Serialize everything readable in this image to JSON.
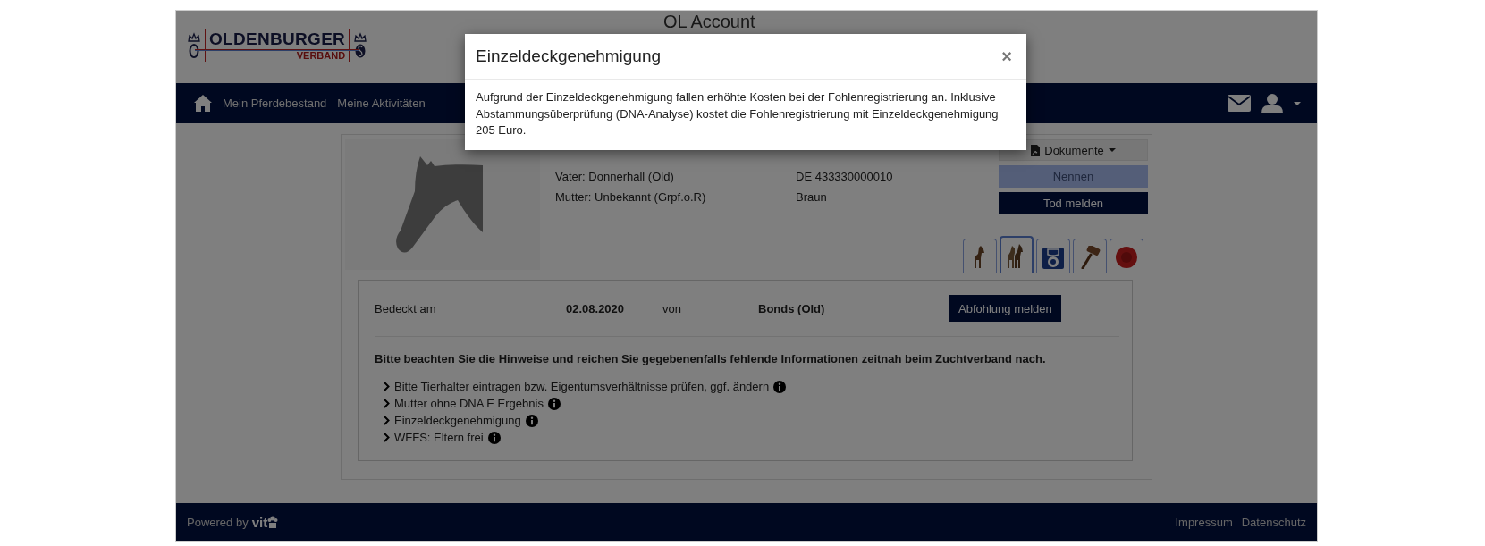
{
  "header": {
    "logo_text": "OLDENBURGER",
    "logo_subtext": "VERBAND",
    "title": "OL Account"
  },
  "nav": {
    "items": [
      {
        "label": "Mein Pferdebestand"
      },
      {
        "label": "Meine Aktivitäten"
      }
    ]
  },
  "horse": {
    "details": [
      {
        "left": "Vater: Donnerhall (Old)",
        "right": "DE 433330000010"
      },
      {
        "left": "Mutter: Unbekannt (Grpf.o.R)",
        "right": "Braun"
      }
    ],
    "actions": [
      {
        "label": "Dokumente",
        "kind": "dropdown",
        "disabled": false
      },
      {
        "label": "Nennen",
        "kind": "button",
        "disabled": true
      },
      {
        "label": "Tod melden",
        "kind": "button",
        "disabled": false
      }
    ],
    "tabs": [
      {
        "kind": "horse",
        "selected": false
      },
      {
        "kind": "horses",
        "selected": true
      },
      {
        "kind": "badge",
        "selected": false
      },
      {
        "kind": "gavel",
        "selected": false
      },
      {
        "kind": "seal",
        "selected": false
      }
    ]
  },
  "breeding": {
    "label": "Bedeckt am",
    "date": "02.08.2020",
    "by_label": "von",
    "stallion": "Bonds (Old)",
    "button": "Abfohlung melden"
  },
  "notice": "Bitte beachten Sie die Hinweise und reichen Sie gegebenenfalls fehlende Informationen zeitnah beim Zuchtverband nach.",
  "hints": [
    {
      "text": "Bitte Tierhalter eintragen bzw. Eigentumsverhältnisse prüfen, ggf. ändern"
    },
    {
      "text": "Mutter ohne DNA E Ergebnis"
    },
    {
      "text": "Einzeldeckgenehmigung"
    },
    {
      "text": "WFFS: Eltern frei"
    }
  ],
  "footer": {
    "powered_by": "Powered by",
    "brand": "vit",
    "links": [
      "Impressum",
      "Datenschutz"
    ]
  },
  "modal": {
    "title": "Einzeldeckgenehmigung",
    "close": "×",
    "body": "Aufgrund der Einzeldeckgenehmigung fallen erhöhte Kosten bei der Fohlenregistrierung an. Inklusive Abstammungsüberprüfung (DNA-Analyse) kostet die Fohlenregistrierung mit Einzeldeckgenehmigung 205 Euro."
  }
}
